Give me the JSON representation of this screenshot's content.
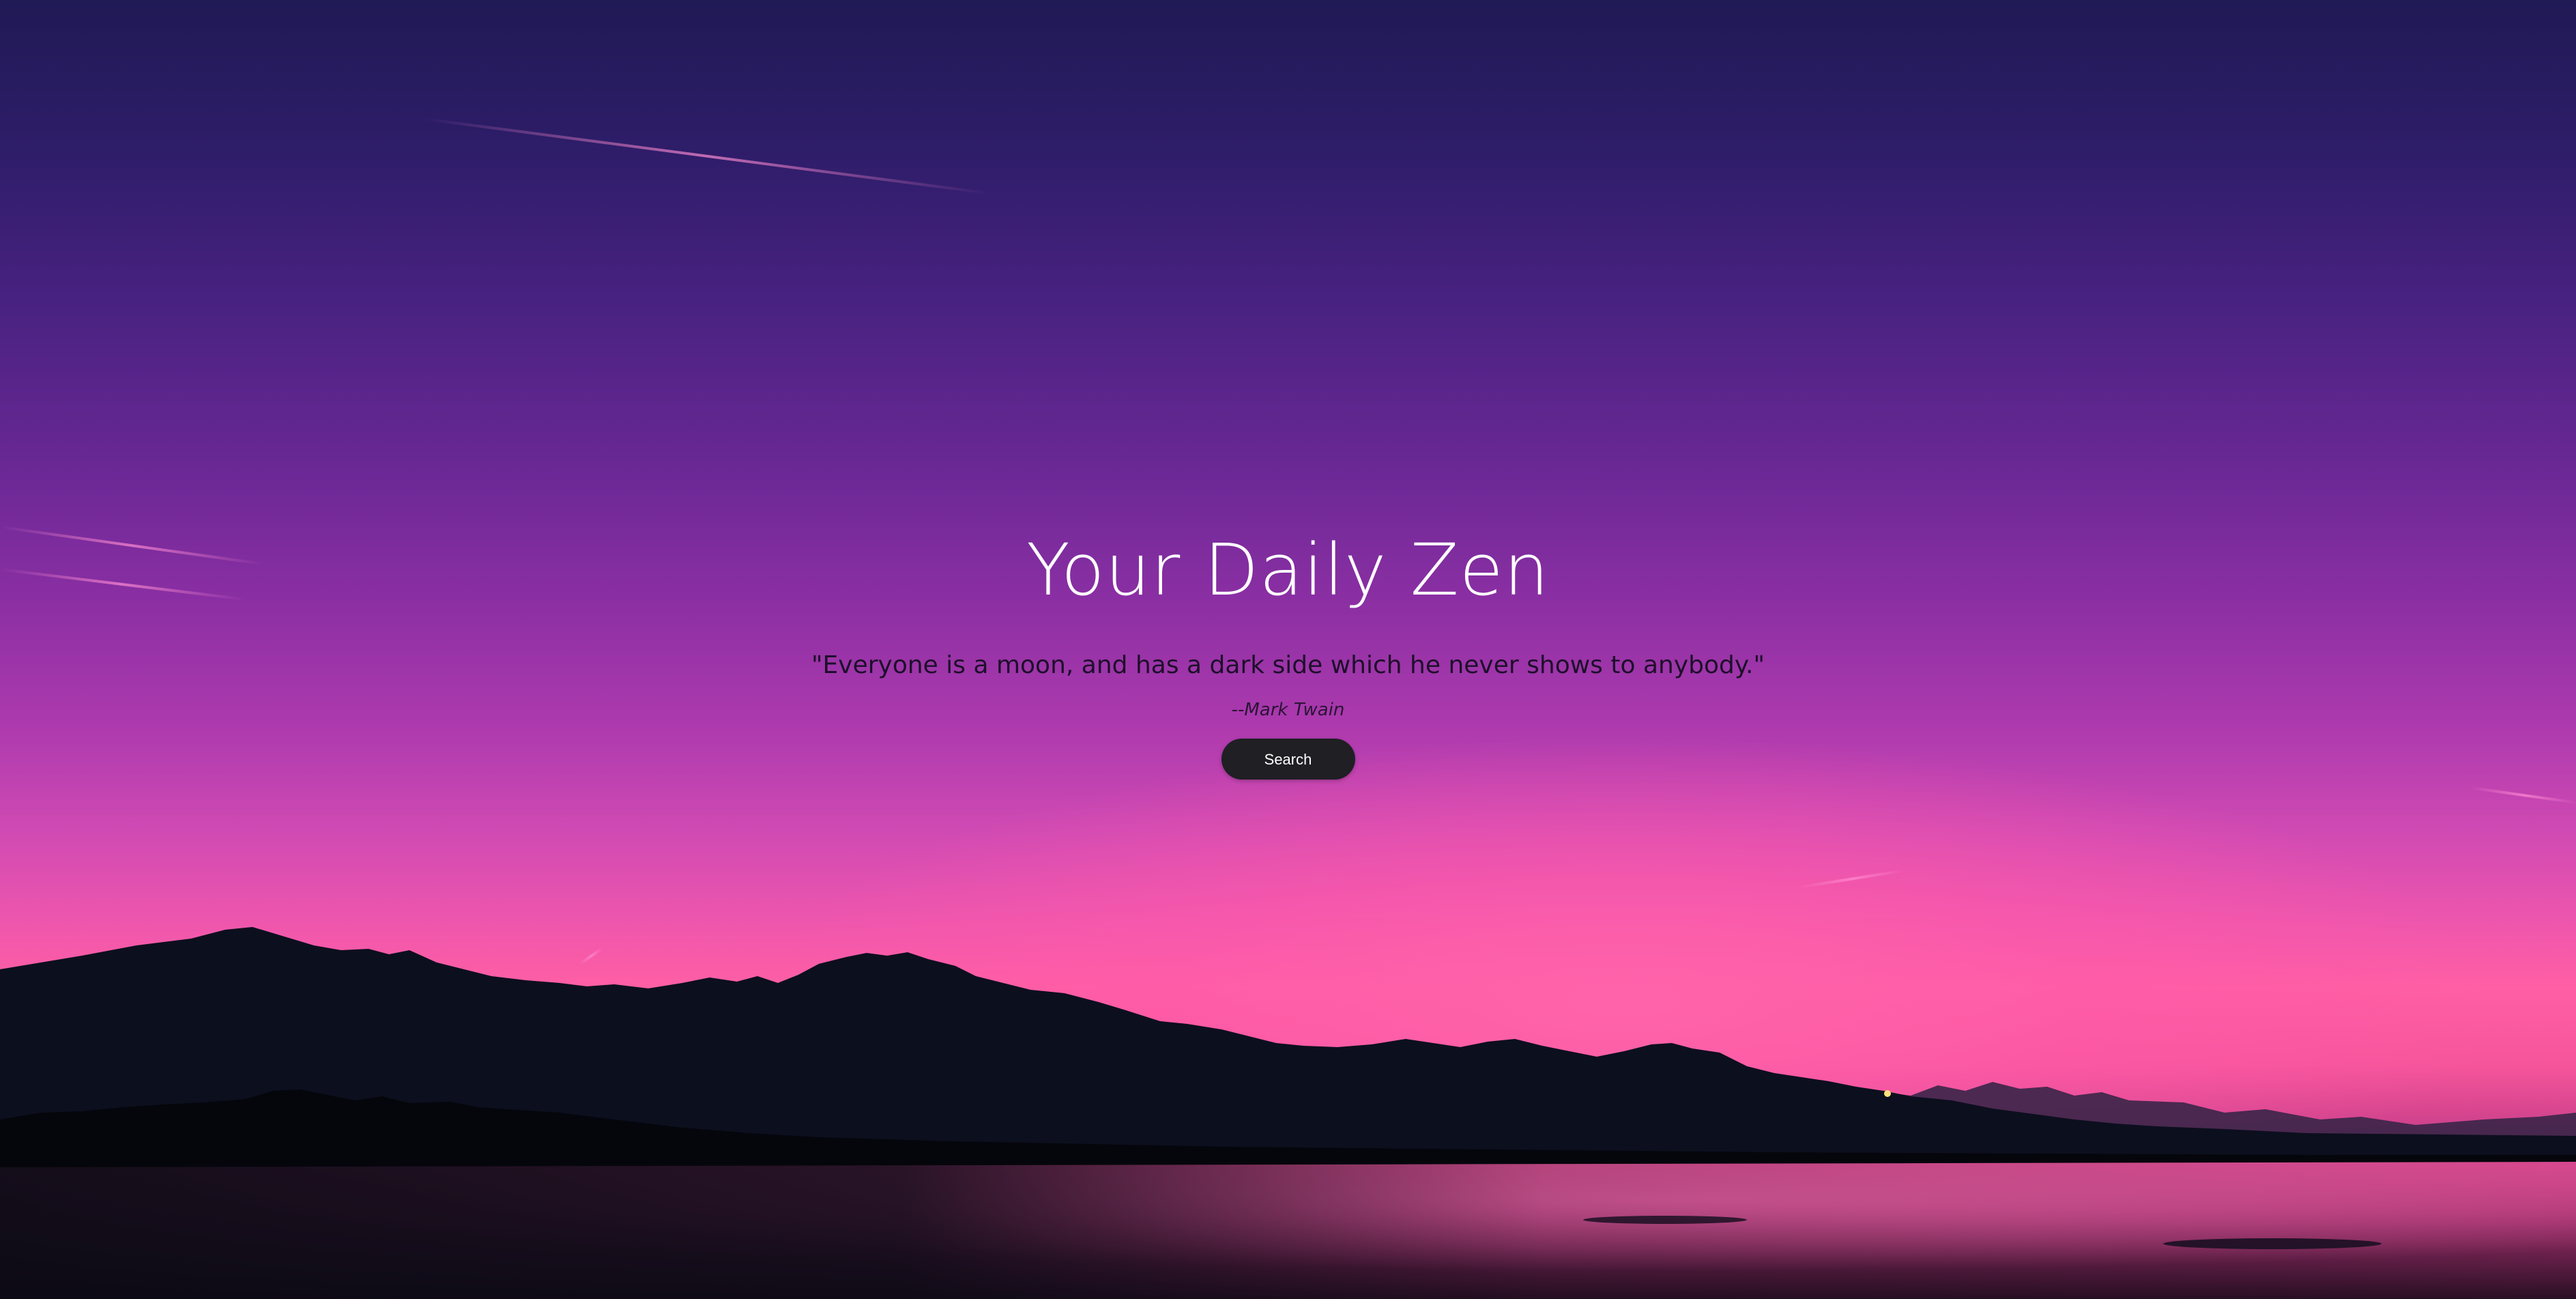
{
  "hero": {
    "title": "Your Daily Zen",
    "quote": "\"Everyone is a moon, and has a dark side which he never shows to anybody.\"",
    "author": "--Mark Twain",
    "search_label": "Search"
  },
  "colors": {
    "sky_top": "#201a55",
    "sky_mid": "#8a2fa3",
    "horizon_glow": "#ff5fa4",
    "mountain": "#0b0e1c",
    "button_bg": "#1f1f24",
    "title_text": "#ffffff"
  }
}
